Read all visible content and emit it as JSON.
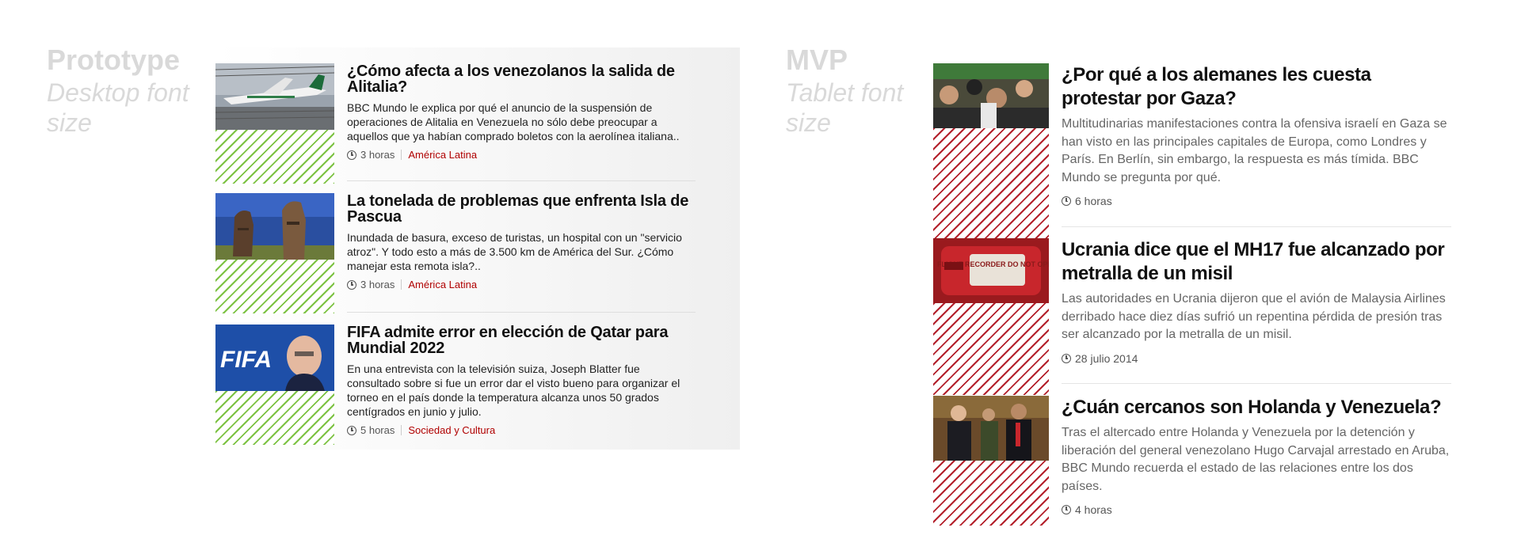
{
  "prototype": {
    "label_title": "Prototype",
    "label_sub": "Desktop font size",
    "stories": [
      {
        "headline": "¿Cómo afecta a los venezolanos la salida de Alitalia?",
        "summary": "BBC Mundo le explica por qué el anuncio de la suspensión de operaciones de Alitalia en Venezuela no sólo debe preocupar a aquellos que ya habían comprado boletos con la aerolínea italiana..",
        "time": "3 horas",
        "category": "América Latina",
        "image": "airplane-photo"
      },
      {
        "headline": "La tonelada de problemas que enfrenta Isla de Pascua",
        "summary": "Inundada de basura, exceso de turistas, un hospital con un \"servicio atroz\". Y todo esto a más de 3.500 km de América del Sur. ¿Cómo manejar esta remota isla?..",
        "time": "3 horas",
        "category": "América Latina",
        "image": "moai-photo"
      },
      {
        "headline": "FIFA admite error en elección de Qatar para Mundial 2022",
        "summary": "En una entrevista con la televisión suiza, Joseph Blatter fue consultado sobre si fue un error dar el visto bueno para organizar el torneo en el país donde la temperatura alcanza unos 50 grados centígrados en junio y julio.",
        "time": "5 horas",
        "category": "Sociedad y Cultura",
        "image": "fifa-photo"
      }
    ]
  },
  "mvp": {
    "label_title": "MVP",
    "label_sub": "Tablet font size",
    "stories": [
      {
        "headline": "¿Por qué a los alemanes les cuesta protestar por Gaza?",
        "summary": "Multitudinarias manifestaciones contra la ofensiva israelí en Gaza se han visto en las principales capitales de Europa, como Londres y París. En Berlín, sin embargo, la respuesta es más tímida. BBC Mundo se pregunta por qué.",
        "time": "6 horas",
        "image": "protest-crowd-photo"
      },
      {
        "headline": "Ucrania dice que el MH17 fue alcanzado por metralla de un misil",
        "summary": "Las autoridades en Ucrania dijeron que el avión de Malaysia Airlines derribado hace diez días sufrió un repentina pérdida de presión tras ser alcanzado por la metralla de un misil.",
        "time": "28 julio 2014",
        "image": "flight-recorder-photo",
        "recorder_text": "FLIGHT RECORDER DO NOT OPEN"
      },
      {
        "headline": "¿Cuán cercanos son Holanda y Venezuela?",
        "summary": "Tras el altercado entre Holanda y Venezuela por la detención y liberación del general venezolano Hugo Carvajal arrestado en Aruba, BBC Mundo recuerda el estado de las relaciones entre los dos países.",
        "time": "4 horas",
        "image": "handshake-photo"
      }
    ]
  },
  "colors": {
    "label_gray": "#d9d9d9",
    "category_red": "#b00000",
    "hatch_green": "#7cc242",
    "hatch_red": "#b3202b"
  }
}
